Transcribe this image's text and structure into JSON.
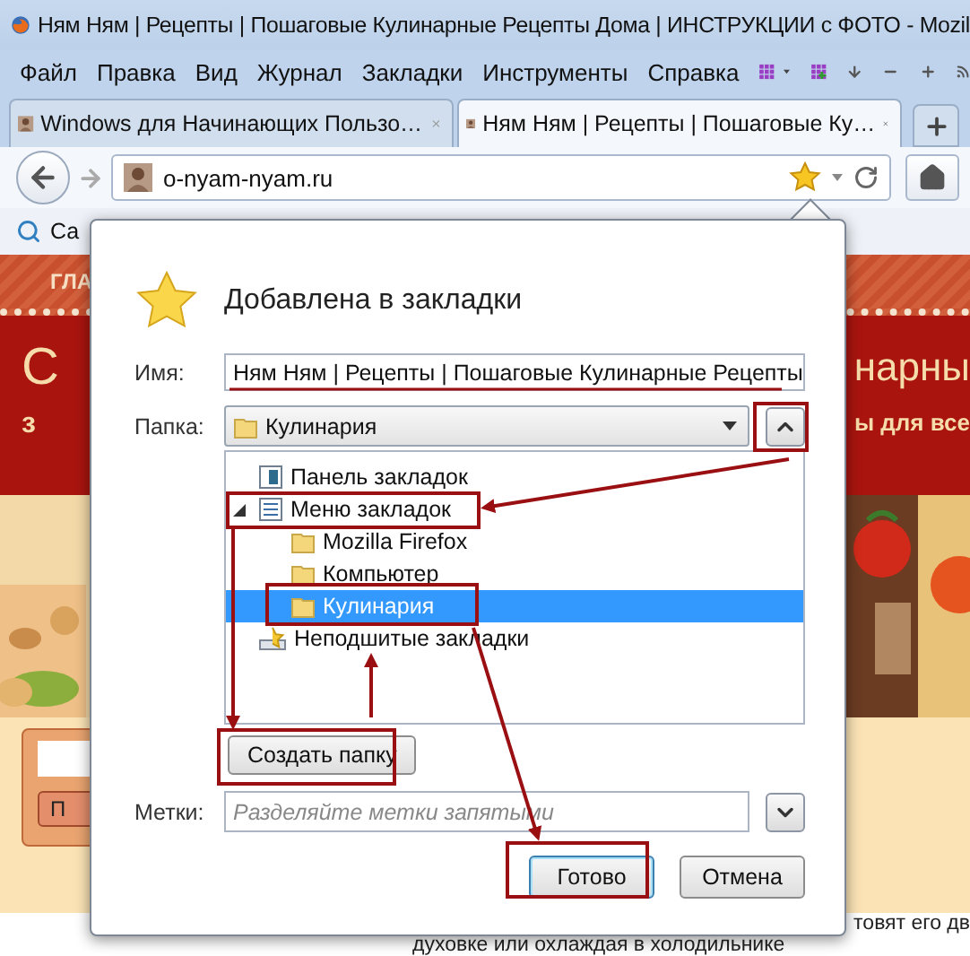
{
  "window": {
    "title": "Ням Ням | Рецепты | Пошаговые Кулинарные Рецепты Дома | ИНСТРУКЦИИ с ФОТО - Mozil"
  },
  "menu": [
    "Файл",
    "Правка",
    "Вид",
    "Журнал",
    "Закладки",
    "Инструменты",
    "Справка"
  ],
  "tabs": [
    {
      "label": "Windows для Начинающих Пользо…",
      "selected": false
    },
    {
      "label": "Ням Ням | Рецепты | Пошаговые Ку…",
      "selected": true
    }
  ],
  "address": {
    "value": "o-nyam-nyam.ru",
    "bookmarked": true
  },
  "bookmarks_bar": {
    "item": "Са"
  },
  "page": {
    "nav_item": "ГЛА",
    "heading_start": "С",
    "heading_end": "нарны",
    "subheading_start": "з",
    "subheading_end": "ы для все",
    "button": "П",
    "text_lines": [
      "товят его дв",
      "духовке или охлаждая в холодильнике"
    ]
  },
  "dialog": {
    "title": "Добавлена в закладки",
    "name_label": "Имя:",
    "name_value": "Ням Ням | Рецепты | Пошаговые Кулинарные Рецепты",
    "folder_label": "Папка:",
    "folder_value": "Кулинария",
    "folder_expanded": true,
    "tree": [
      {
        "label": "Панель закладок",
        "kind": "toolbar",
        "selected": false
      },
      {
        "label": "Меню закладок",
        "kind": "menu",
        "selected": false,
        "expanded": true,
        "children": [
          {
            "label": "Mozilla Firefox",
            "kind": "folder",
            "selected": false
          },
          {
            "label": "Компьютер",
            "kind": "folder",
            "selected": false
          },
          {
            "label": "Кулинария",
            "kind": "folder",
            "selected": true
          }
        ]
      },
      {
        "label": "Неподшитые закладки",
        "kind": "unsorted",
        "selected": false
      }
    ],
    "new_folder_button": "Создать папку",
    "tags_label": "Метки:",
    "tags_placeholder": "Разделяйте метки запятыми",
    "buttons": [
      {
        "label": "Готово",
        "kind": "primary"
      },
      {
        "label": "Отмена",
        "kind": "secondary"
      }
    ]
  }
}
